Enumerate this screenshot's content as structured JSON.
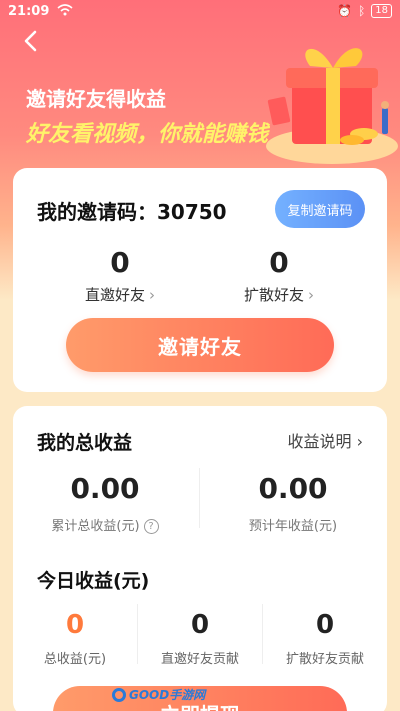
{
  "status_bar": {
    "time": "21:09",
    "battery": "18"
  },
  "hero": {
    "title": "邀请好友得收益",
    "subtitle": "好友看视频，你就能赚钱"
  },
  "invite_card": {
    "code_label": "我的邀请码：",
    "code_value": "30750",
    "copy_button": "复制邀请码",
    "stats": [
      {
        "value": "0",
        "label": "直邀好友"
      },
      {
        "value": "0",
        "label": "扩散好友"
      }
    ],
    "invite_button": "邀请好友"
  },
  "earnings_card": {
    "title": "我的总收益",
    "explain_link": "收益说明",
    "totals": [
      {
        "value": "0.00",
        "label": "累计总收益(元)"
      },
      {
        "value": "0.00",
        "label": "预计年收益(元)"
      }
    ],
    "today_title": "今日收益(元)",
    "today": [
      {
        "value": "0",
        "label": "总收益(元)"
      },
      {
        "value": "0",
        "label": "直邀好友贡献"
      },
      {
        "value": "0",
        "label": "扩散好友贡献"
      }
    ],
    "withdraw_button": "立即提现"
  },
  "watermark": "GOOD手游网",
  "colors": {
    "accent": "#ff6b57",
    "highlight": "#fff36a",
    "copy_button": "#5b91f5",
    "today_total": "#ff7a3c"
  }
}
